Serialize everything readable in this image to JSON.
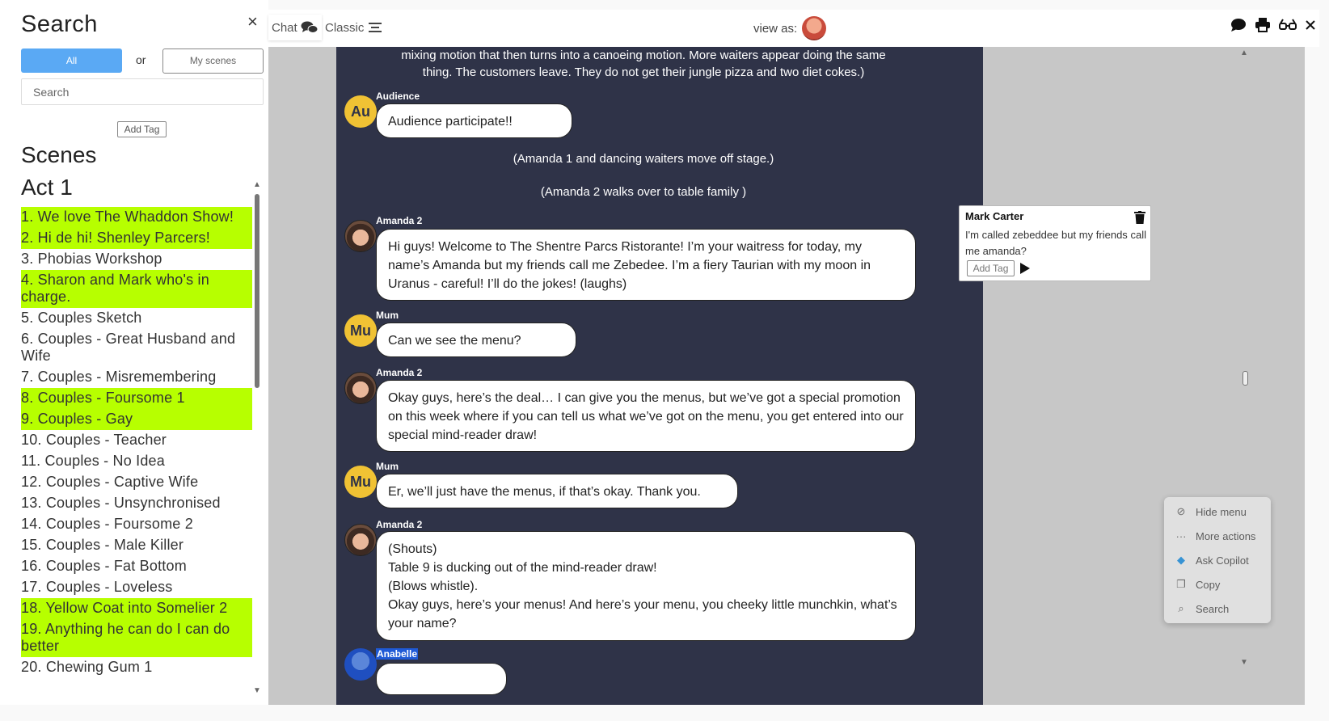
{
  "sidebar": {
    "title": "Search",
    "close_icon": "×",
    "all_label": "All",
    "or_label": "or",
    "my_scenes_label": "My scenes",
    "search_placeholder": "Search",
    "add_tag_label": "Add Tag",
    "scenes_heading": "Scenes",
    "act_heading": "Act 1",
    "scenes": [
      {
        "label": "1. We love The Whaddon Show!",
        "highlighted": true
      },
      {
        "label": "2. Hi de hi! Shenley Parcers!",
        "highlighted": true
      },
      {
        "label": "3. Phobias Workshop",
        "highlighted": false
      },
      {
        "label": "4. Sharon and Mark who's in charge.",
        "highlighted": true
      },
      {
        "label": "5. Couples Sketch",
        "highlighted": false
      },
      {
        "label": "6. Couples - Great Husband and Wife",
        "highlighted": false
      },
      {
        "label": "7. Couples - Misremembering",
        "highlighted": false
      },
      {
        "label": "8. Couples - Foursome 1",
        "highlighted": true
      },
      {
        "label": "9. Couples - Gay",
        "highlighted": true
      },
      {
        "label": "10. Couples - Teacher",
        "highlighted": false
      },
      {
        "label": "11. Couples - No Idea",
        "highlighted": false
      },
      {
        "label": "12. Couples - Captive Wife",
        "highlighted": false
      },
      {
        "label": "13. Couples - Unsynchronised",
        "highlighted": false
      },
      {
        "label": "14. Couples - Foursome 2",
        "highlighted": false
      },
      {
        "label": "15. Couples - Male Killer",
        "highlighted": false
      },
      {
        "label": "16. Couples - Fat Bottom",
        "highlighted": false
      },
      {
        "label": "17. Couples - Loveless",
        "highlighted": false
      },
      {
        "label": "18. Yellow Coat into Somelier 2",
        "highlighted": true
      },
      {
        "label": "19. Anything he can do I can do better",
        "highlighted": true
      },
      {
        "label": "20. Chewing Gum 1",
        "highlighted": false
      }
    ]
  },
  "topbar": {
    "chat_label": "Chat",
    "classic_label": "Classic",
    "view_as_label": "view as:",
    "icons": [
      "comment-icon",
      "print-icon",
      "glasses-icon",
      "close-icon"
    ]
  },
  "chat": {
    "stage_top": "mixing motion that then turns into a canoeing motion. More waiters appear doing the same thing. The customers leave. They do not get their jungle pizza and two diet cokes.)",
    "stage_1": "(Amanda 1 and dancing waiters move off stage.)",
    "stage_2": "(Amanda 2 walks over to table family )",
    "messages": [
      {
        "speaker": "Audience",
        "initials": "Au",
        "text": "Audience participate!!"
      },
      {
        "speaker": "Amanda 2",
        "text": "Hi guys! Welcome to The Shentre Parcs Ristorante! I’m your waitress for today, my name’s Amanda but my friends call me Zebedee. I’m a fiery Taurian with my moon in Uranus - careful! I’ll do the jokes! (laughs)"
      },
      {
        "speaker": "Mum",
        "initials": "Mu",
        "text": "Can we see the menu?"
      },
      {
        "speaker": "Amanda 2",
        "text": "Okay guys, here’s the deal… I can give you the menus, but we’ve got a special promotion on this week where if you can tell us what we’ve got on the menu, you get entered into our special mind-reader draw!"
      },
      {
        "speaker": "Mum",
        "initials": "Mu",
        "text": "Er, we’ll just have the menus, if that’s okay. Thank you."
      },
      {
        "speaker": "Amanda 2",
        "lines": [
          "(Shouts)",
          "Table 9 is ducking out of the mind-reader draw!",
          "(Blows whistle).",
          "Okay guys, here’s your menus! And here’s your menu, you cheeky little munchkin, what’s your name?"
        ]
      },
      {
        "speaker": "Anabelle",
        "text": ""
      }
    ]
  },
  "comment": {
    "author": "Mark Carter",
    "text": "I'm called zebeddee but my friends call me amanda?",
    "add_tag_label": "Add Tag"
  },
  "context_menu": {
    "items": [
      "Hide menu",
      "More actions",
      "Ask Copilot",
      "Copy",
      "Search"
    ]
  }
}
